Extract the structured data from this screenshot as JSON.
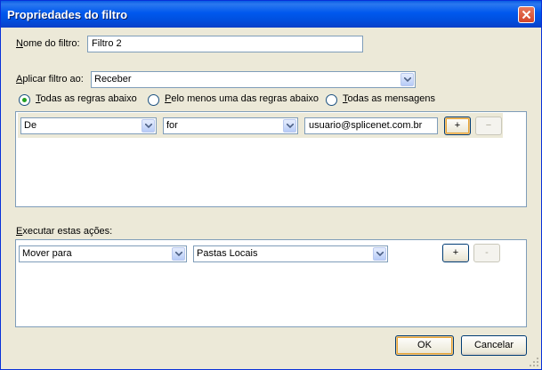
{
  "window": {
    "title": "Propriedades do filtro"
  },
  "filter_name": {
    "label_accel": "N",
    "label_rest": "ome do filtro:",
    "value": "Filtro 2"
  },
  "apply_filter": {
    "label_accel": "A",
    "label_rest": "plicar filtro ao:",
    "value": "Receber"
  },
  "match": {
    "options": [
      {
        "accel": "T",
        "rest": "odas as regras abaixo",
        "checked": true
      },
      {
        "accel": "P",
        "rest": "elo menos uma das regras abaixo",
        "checked": false
      },
      {
        "accel": "T",
        "rest": "odas as mensagens",
        "checked": false
      }
    ]
  },
  "rules": [
    {
      "field": "De",
      "operator": "for",
      "value": "usuario@splicenet.com.br",
      "add_label": "+",
      "remove_label": "−"
    }
  ],
  "actions": {
    "label_accel": "E",
    "label_rest": "xecutar estas ações:",
    "items": [
      {
        "action": "Mover para",
        "target": "Pastas Locais",
        "add_label": "+",
        "remove_label": "-"
      }
    ]
  },
  "buttons": {
    "ok": "OK",
    "cancel": "Cancelar"
  },
  "colors": {
    "title_bar": "#0058ee",
    "dialog_bg": "#ece9d8",
    "field_border": "#7f9db9",
    "radio_dot": "#21a121",
    "close_button": "#d2452a"
  }
}
